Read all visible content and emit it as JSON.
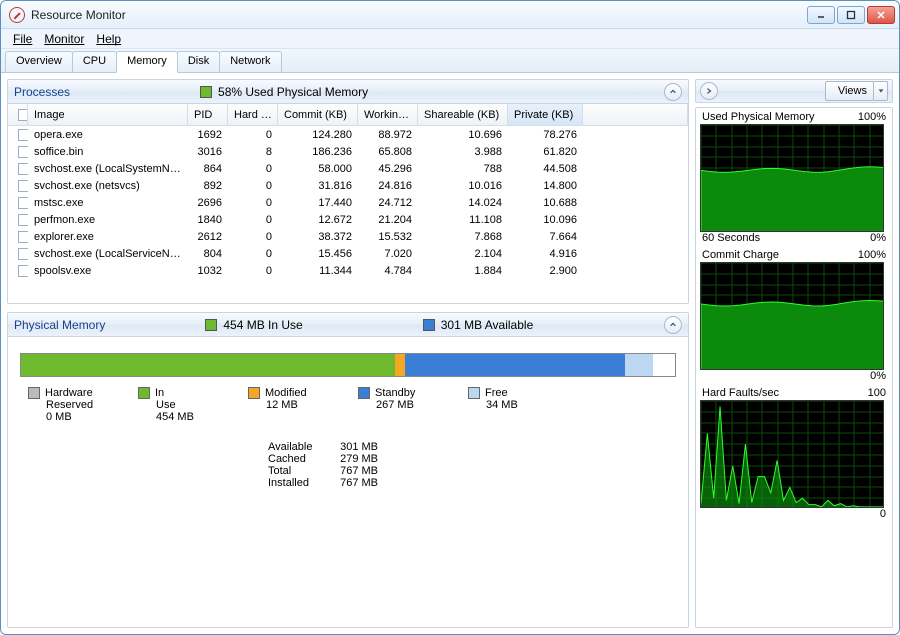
{
  "app_title": "Resource Monitor",
  "menus": [
    "File",
    "Monitor",
    "Help"
  ],
  "tabs": [
    {
      "label": "Overview",
      "active": false
    },
    {
      "label": "CPU",
      "active": false
    },
    {
      "label": "Memory",
      "active": true
    },
    {
      "label": "Disk",
      "active": false
    },
    {
      "label": "Network",
      "active": false
    }
  ],
  "processes_panel": {
    "title": "Processes",
    "indicator_color": "#6fb92f",
    "indicator_text": "58% Used Physical Memory",
    "columns": [
      "Image",
      "PID",
      "Hard …",
      "Commit (KB)",
      "Workin…",
      "Shareable (KB)",
      "Private (KB)"
    ],
    "sorted_col": 6,
    "rows": [
      {
        "image": "opera.exe",
        "pid": "1692",
        "hard": "0",
        "commit": "124.280",
        "work": "88.972",
        "share": "10.696",
        "priv": "78.276"
      },
      {
        "image": "soffice.bin",
        "pid": "3016",
        "hard": "8",
        "commit": "186.236",
        "work": "65.808",
        "share": "3.988",
        "priv": "61.820"
      },
      {
        "image": "svchost.exe (LocalSystemNet…",
        "pid": "864",
        "hard": "0",
        "commit": "58.000",
        "work": "45.296",
        "share": "788",
        "priv": "44.508"
      },
      {
        "image": "svchost.exe (netsvcs)",
        "pid": "892",
        "hard": "0",
        "commit": "31.816",
        "work": "24.816",
        "share": "10.016",
        "priv": "14.800"
      },
      {
        "image": "mstsc.exe",
        "pid": "2696",
        "hard": "0",
        "commit": "17.440",
        "work": "24.712",
        "share": "14.024",
        "priv": "10.688"
      },
      {
        "image": "perfmon.exe",
        "pid": "1840",
        "hard": "0",
        "commit": "12.672",
        "work": "21.204",
        "share": "11.108",
        "priv": "10.096"
      },
      {
        "image": "explorer.exe",
        "pid": "2612",
        "hard": "0",
        "commit": "38.372",
        "work": "15.532",
        "share": "7.868",
        "priv": "7.664"
      },
      {
        "image": "svchost.exe (LocalServiceNet…",
        "pid": "804",
        "hard": "0",
        "commit": "15.456",
        "work": "7.020",
        "share": "2.104",
        "priv": "4.916"
      },
      {
        "image": "spoolsv.exe",
        "pid": "1032",
        "hard": "0",
        "commit": "11.344",
        "work": "4.784",
        "share": "1.884",
        "priv": "2.900"
      }
    ]
  },
  "physical_panel": {
    "title": "Physical Memory",
    "in_use_color": "#6fb92f",
    "in_use_text": "454 MB In Use",
    "avail_color": "#3a7fd5",
    "avail_text": "301 MB Available",
    "segments": [
      {
        "color": "#6fb92f",
        "width": 57.2
      },
      {
        "color": "#f5a623",
        "width": 1.5
      },
      {
        "color": "#3a7fd5",
        "width": 33.6
      },
      {
        "color": "#bcd7f2",
        "width": 4.3
      }
    ],
    "legend": [
      {
        "name": "Hardware Reserved",
        "color": "#bbbbbb",
        "value": "0 MB"
      },
      {
        "name": "In Use",
        "color": "#6fb92f",
        "value": "454 MB"
      },
      {
        "name": "Modified",
        "color": "#f5a623",
        "value": "12 MB"
      },
      {
        "name": "Standby",
        "color": "#3a7fd5",
        "value": "267 MB"
      },
      {
        "name": "Free",
        "color": "#bcd7f2",
        "value": "34 MB"
      }
    ],
    "summary": [
      {
        "k": "Available",
        "v": "301 MB"
      },
      {
        "k": "Cached",
        "v": "279 MB"
      },
      {
        "k": "Total",
        "v": "767 MB"
      },
      {
        "k": "Installed",
        "v": "767 MB"
      }
    ]
  },
  "right": {
    "views_label": "Views",
    "graphs": [
      {
        "title": "Used Physical Memory",
        "tr": "100%",
        "bl": "60 Seconds",
        "br": "0%",
        "type": "area",
        "level": 0.58
      },
      {
        "title": "Commit Charge",
        "tr": "100%",
        "bl": "",
        "br": "0%",
        "type": "area",
        "level": 0.62
      },
      {
        "title": "Hard Faults/sec",
        "tr": "100",
        "bl": "",
        "br": "0",
        "type": "spikes"
      }
    ]
  },
  "chart_data": [
    {
      "type": "area",
      "title": "Used Physical Memory",
      "ylabel": "%",
      "ylim": [
        0,
        100
      ],
      "xrange": "60 Seconds",
      "approx_level": 58
    },
    {
      "type": "area",
      "title": "Commit Charge",
      "ylabel": "%",
      "ylim": [
        0,
        100
      ],
      "xrange": "60 Seconds",
      "approx_level": 62
    },
    {
      "type": "line",
      "title": "Hard Faults/sec",
      "ylim": [
        0,
        100
      ],
      "xrange": "60 Seconds",
      "series": [
        {
          "name": "Hard Faults/sec",
          "values": [
            5,
            70,
            10,
            95,
            8,
            40,
            5,
            60,
            6,
            30,
            30,
            15,
            45,
            8,
            20,
            6,
            10,
            4,
            4,
            2,
            8,
            3,
            5,
            2,
            3,
            2,
            2,
            2,
            2,
            2
          ]
        }
      ]
    },
    {
      "type": "bar",
      "title": "Physical Memory Breakdown (MB)",
      "categories": [
        "Hardware Reserved",
        "In Use",
        "Modified",
        "Standby",
        "Free"
      ],
      "values": [
        0,
        454,
        12,
        267,
        34
      ],
      "total": 767
    }
  ]
}
